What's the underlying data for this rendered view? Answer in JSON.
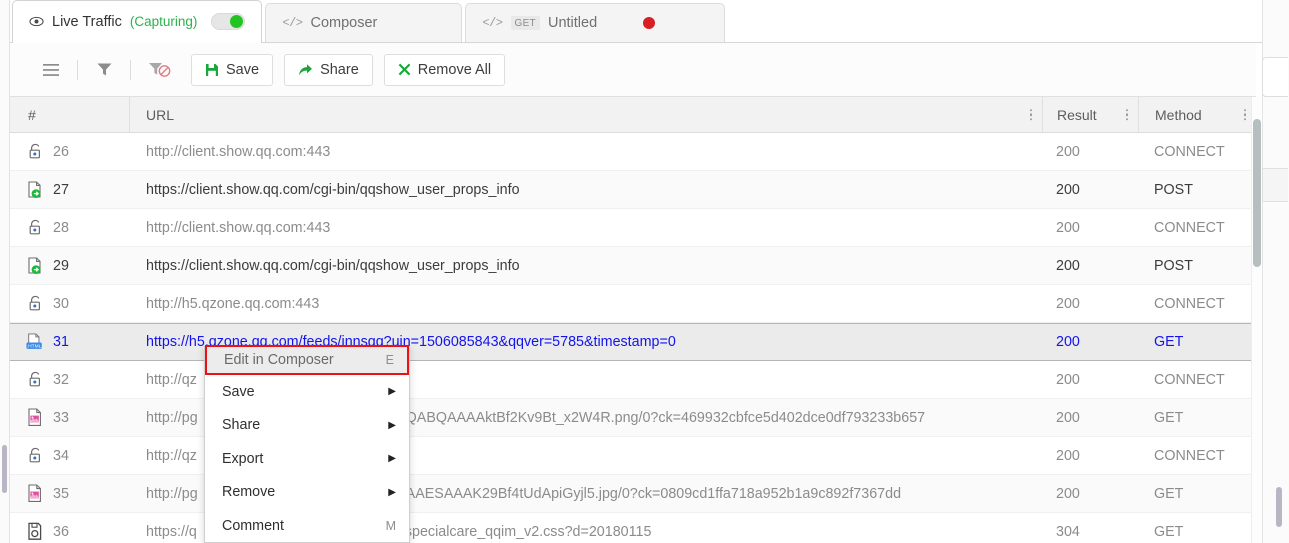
{
  "tabs": [
    {
      "id": "live-traffic",
      "icon": "eye-icon",
      "label": "Live Traffic",
      "status": "(Capturing)",
      "active": true,
      "toggle": "on"
    },
    {
      "id": "composer",
      "icon": "code-icon",
      "label": "Composer",
      "active": false
    },
    {
      "id": "untitled",
      "icon": "code-icon",
      "verb": "GET",
      "label": "Untitled",
      "active": false,
      "indicator": "red-dot"
    }
  ],
  "toolbar": {
    "icons": [
      {
        "name": "hamburger-menu-icon",
        "glyph": "☰"
      },
      {
        "name": "filter-icon",
        "glyph": "filter"
      },
      {
        "name": "filter-off-icon",
        "glyph": "filter-off"
      }
    ],
    "buttons": [
      {
        "name": "save-button",
        "icon": "floppy-disk-icon",
        "label": "Save"
      },
      {
        "name": "share-button",
        "icon": "share-arrow-icon",
        "label": "Share"
      },
      {
        "name": "remove-all-button",
        "icon": "cross-icon",
        "label": "Remove All"
      }
    ]
  },
  "table": {
    "headers": {
      "num": "#",
      "url": "URL",
      "result": "Result",
      "method": "Method"
    },
    "rows": [
      {
        "icon": "lock-icon",
        "num": "26",
        "url": "http://client.show.qq.com:443",
        "result": "200",
        "method": "CONNECT",
        "style": "dim"
      },
      {
        "icon": "post-doc-icon",
        "num": "27",
        "url": "https://client.show.qq.com/cgi-bin/qqshow_user_props_info",
        "result": "200",
        "method": "POST",
        "style": "strong"
      },
      {
        "icon": "lock-icon",
        "num": "28",
        "url": "http://client.show.qq.com:443",
        "result": "200",
        "method": "CONNECT",
        "style": "dim"
      },
      {
        "icon": "post-doc-icon",
        "num": "29",
        "url": "https://client.show.qq.com/cgi-bin/qqshow_user_props_info",
        "result": "200",
        "method": "POST",
        "style": "strong"
      },
      {
        "icon": "lock-icon",
        "num": "30",
        "url": "http://h5.qzone.qq.com:443",
        "result": "200",
        "method": "CONNECT",
        "style": "dim"
      },
      {
        "icon": "html-doc-icon",
        "num": "31",
        "url": "https://h5.qzone.qq.com/feeds/innsgq?uin=1506085843&qqver=5785&timestamp=0",
        "result": "200",
        "method": "GET",
        "style": "selected"
      },
      {
        "icon": "lock-icon",
        "num": "32",
        "url": "http://qz",
        "result": "200",
        "method": "CONNECT",
        "style": "dim"
      },
      {
        "icon": "image-doc-icon",
        "num": "33",
        "url": "http://pg",
        "url_tail": "QABQAAAAktBf2Kv9Bt_x2W4R.png/0?ck=469932cbfce5d402dce0df793233b657",
        "result": "200",
        "method": "GET",
        "style": "dim"
      },
      {
        "icon": "lock-icon",
        "num": "34",
        "url": "http://qz",
        "result": "200",
        "method": "CONNECT",
        "style": "dim"
      },
      {
        "icon": "image-doc-icon",
        "num": "35",
        "url": "http://pg",
        "url_tail": "AAESAAAK29Bf4tUdApiGyjl5.jpg/0?ck=0809cd1ffa718a952b1a9c892f7367dd",
        "result": "200",
        "method": "GET",
        "style": "dim"
      },
      {
        "icon": "css-doc-icon",
        "num": "36",
        "url": "https://q",
        "url_tail": "specialcare_qqim_v2.css?d=20180115",
        "result": "304",
        "method": "GET",
        "style": "dim"
      }
    ]
  },
  "context_menu": {
    "items": [
      {
        "label": "Edit in Composer",
        "accel": "E",
        "submenu": false,
        "highlighted": true
      },
      {
        "label": "Save",
        "accel": "",
        "submenu": true,
        "highlighted": false
      },
      {
        "label": "Share",
        "accel": "",
        "submenu": true,
        "highlighted": false
      },
      {
        "label": "Export",
        "accel": "",
        "submenu": true,
        "highlighted": false
      },
      {
        "label": "Remove",
        "accel": "",
        "submenu": true,
        "highlighted": false
      },
      {
        "label": "Comment",
        "accel": "M",
        "submenu": false,
        "highlighted": false
      }
    ],
    "arrow": "▶"
  },
  "colors": {
    "accent_green": "#1aa63a",
    "capturing_green": "#2bb24c",
    "selected_blue": "#1313ee",
    "highlight_red": "#ee1111",
    "record_red": "#d81f26"
  }
}
